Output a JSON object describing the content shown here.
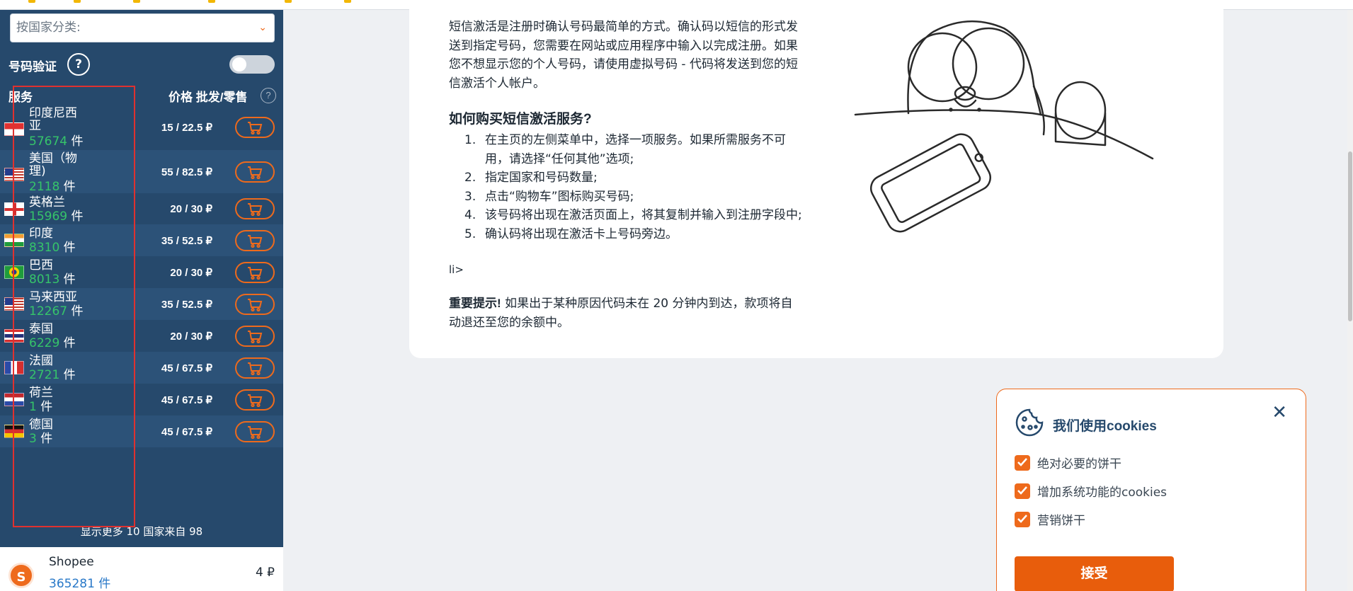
{
  "sidebar": {
    "country_placeholder": "按国家分类:",
    "verify_label": "号码验证",
    "help_glyph": "?",
    "col_service": "服务",
    "col_price": "价格 批发/零售",
    "col_help_glyph": "?",
    "unit": "件",
    "rows": [
      {
        "name": "印度尼西亚",
        "count": "57674",
        "price": "15 / 22.5 ₽",
        "flag": "indonesia"
      },
      {
        "name": "美国（物理)",
        "count": "2118",
        "price": "55 / 82.5 ₽",
        "flag": "usa"
      },
      {
        "name": "英格兰",
        "count": "15969",
        "price": "20 / 30 ₽",
        "flag": "england"
      },
      {
        "name": "印度",
        "count": "8310",
        "price": "35 / 52.5 ₽",
        "flag": "india"
      },
      {
        "name": "巴西",
        "count": "8013",
        "price": "20 / 30 ₽",
        "flag": "brazil"
      },
      {
        "name": "马来西亚",
        "count": "12267",
        "price": "35 / 52.5 ₽",
        "flag": "malaysia"
      },
      {
        "name": "泰国",
        "count": "6229",
        "price": "20 / 30 ₽",
        "flag": "thailand"
      },
      {
        "name": "法國",
        "count": "2721",
        "price": "45 / 67.5 ₽",
        "flag": "france"
      },
      {
        "name": "荷兰",
        "count": "1",
        "price": "45 / 67.5 ₽",
        "flag": "netherlands"
      },
      {
        "name": "德国",
        "count": "3",
        "price": "45 / 67.5 ₽",
        "flag": "germany"
      }
    ],
    "more_link": "显示更多 10 国家来自 98",
    "shopee": {
      "name": "Shopee",
      "count": "365281 件",
      "price": "4 ₽",
      "logo_letter": "S"
    }
  },
  "content": {
    "intro": "短信激活是注册时确认号码最简单的方式。确认码以短信的形式发送到指定号码，您需要在网站或应用程序中输入以完成注册。如果您不想显示您的个人号码，请使用虚拟号码 - 代码将发送到您的短信激活个人帐户。",
    "howto_title": "如何购买短信激活服务?",
    "steps": [
      {
        "n": "1.",
        "text": "在主页的左侧菜单中，选择一项服务。如果所需服务不可用，请选择“任何其他”选项;"
      },
      {
        "n": "2.",
        "text": "指定国家和号码数量;"
      },
      {
        "n": "3.",
        "text": "点击“购物车”图标购买号码;"
      },
      {
        "n": "4.",
        "text": "该号码将出现在激活页面上，将其复制并输入到注册字段中;"
      },
      {
        "n": "5.",
        "text": "确认码将出现在激活卡上号码旁边。"
      }
    ],
    "stray_text": "li>",
    "notice_bold": "重要提示!",
    "notice_text": " 如果出于某种原因代码未在 20 分钟内到达，款项将自动退还至您的余额中。"
  },
  "cookie": {
    "title": "我们使用cookies",
    "close_glyph": "✕",
    "options": [
      "绝对必要的饼干",
      "增加系统功能的cookies",
      "营销饼干"
    ],
    "accept": "接受"
  },
  "colors": {
    "accent": "#ee6a1c",
    "sidebar": "#26496c",
    "count_green": "#36c46a"
  }
}
